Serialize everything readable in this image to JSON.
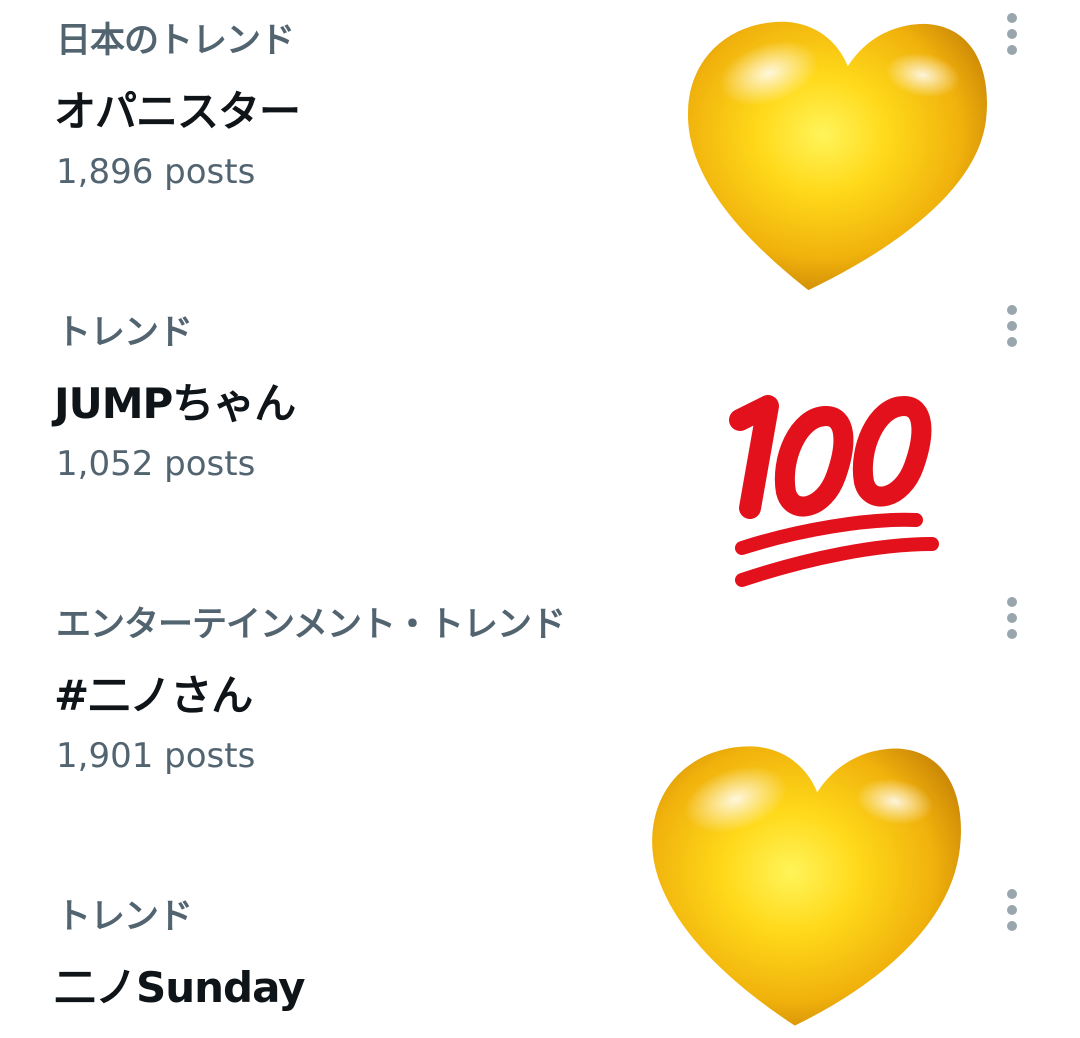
{
  "trends": [
    {
      "context": "日本のトレンド",
      "name": "オパニスター",
      "count": "1,896 posts"
    },
    {
      "context": "トレンド",
      "name": "JUMPちゃん",
      "count": "1,052 posts"
    },
    {
      "context": "エンターテインメント・トレンド",
      "name": "#二ノさん",
      "count": "1,901 posts"
    },
    {
      "context": "トレンド",
      "name": "二ノSunday",
      "count": ""
    }
  ],
  "icons": {
    "more": "more-options-icon",
    "overlay_1": "yellow-heart-emoji",
    "overlay_2": "hundred-points-emoji",
    "overlay_3": "yellow-heart-emoji"
  },
  "colors": {
    "secondary_text": "#536471",
    "primary_text": "#0f1419",
    "icon_gray": "#9aa6ae",
    "heart_gold": "#f5bd0e",
    "hundred_red": "#e3111b"
  }
}
